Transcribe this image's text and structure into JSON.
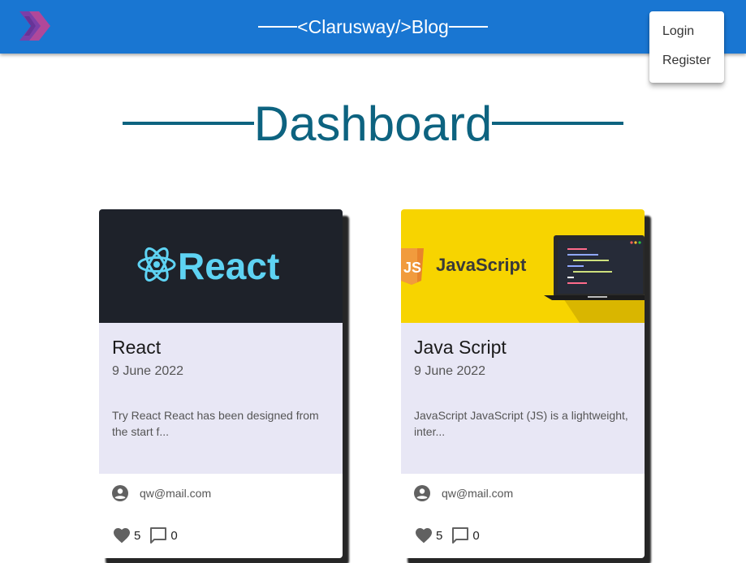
{
  "appbar": {
    "brand": "<Clarusway/>Blog",
    "background": "#1976d2"
  },
  "menu": {
    "items": [
      {
        "label": "Login"
      },
      {
        "label": "Register"
      }
    ]
  },
  "dashboard": {
    "title": "Dashboard",
    "color": "#0d6380"
  },
  "cards": [
    {
      "image_logo_text": "React",
      "title": "React",
      "date": "9 June 2022",
      "excerpt": "Try React React has been designed from the start f...",
      "author": "qw@mail.com",
      "likes": "5",
      "comments": "0"
    },
    {
      "image_logo_text": "JavaScript",
      "image_badge_text": "JS",
      "title": "Java Script",
      "date": "9 June 2022",
      "excerpt": "JavaScript JavaScript (JS) is a lightweight, inter...",
      "author": "qw@mail.com",
      "likes": "5",
      "comments": "0"
    }
  ],
  "icons": {
    "logo": "chevron-double-logo-icon",
    "author": "account-circle-icon",
    "like": "heart-icon",
    "comment": "comment-icon"
  }
}
